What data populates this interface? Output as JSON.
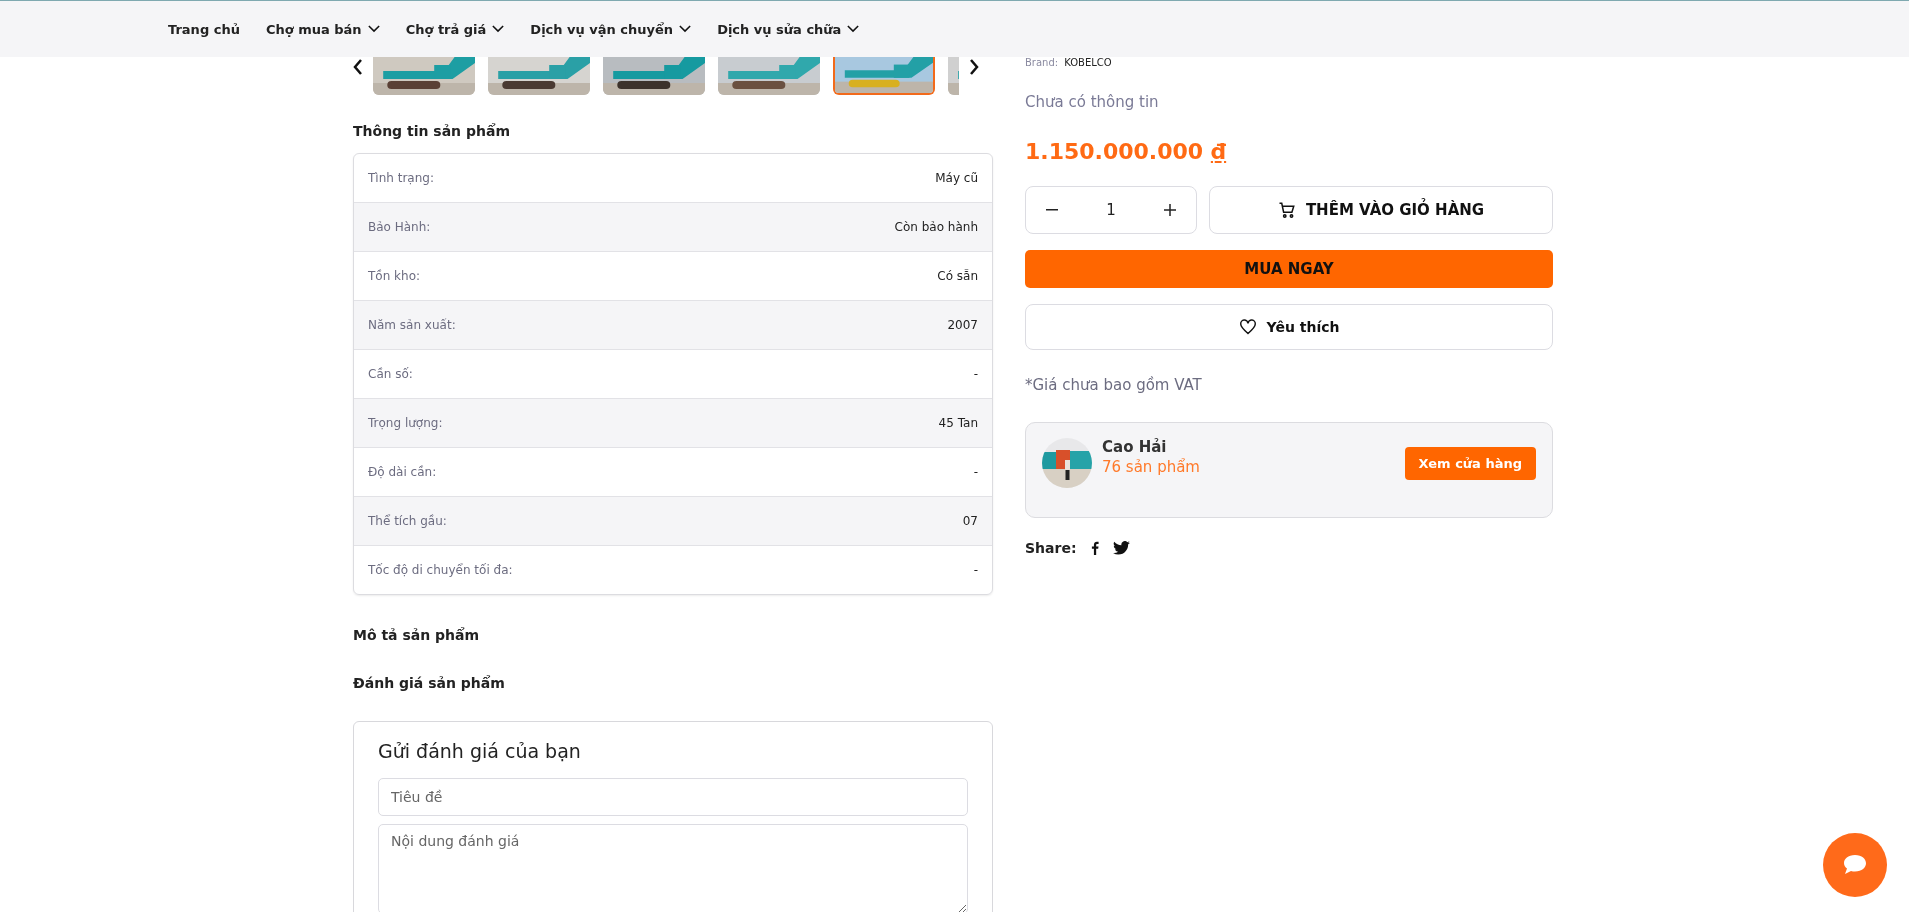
{
  "nav": {
    "items": [
      {
        "label": "Trang chủ",
        "dropdown": false
      },
      {
        "label": "Chợ mua bán",
        "dropdown": true
      },
      {
        "label": "Chợ trả giá",
        "dropdown": true
      },
      {
        "label": "Dịch vụ vận chuyển",
        "dropdown": true
      },
      {
        "label": "Dịch vụ sửa chữa",
        "dropdown": true
      }
    ]
  },
  "gallery": {
    "thumbnails": [
      {
        "kind": "picture",
        "selected": false
      },
      {
        "kind": "picture",
        "selected": false
      },
      {
        "kind": "picture",
        "selected": false
      },
      {
        "kind": "picture",
        "selected": false
      },
      {
        "kind": "picture",
        "selected": true
      },
      {
        "kind": "picture",
        "selected": false
      }
    ]
  },
  "product_info": {
    "title": "Thông tin sản phẩm",
    "rows": [
      {
        "label": "Tình trạng:",
        "value": "Máy cũ"
      },
      {
        "label": "Bảo Hành:",
        "value": "Còn bảo hành"
      },
      {
        "label": "Tồn kho:",
        "value": "Có sẵn"
      },
      {
        "label": "Năm sản xuất:",
        "value": "2007"
      },
      {
        "label": "Cần số:",
        "value": "-"
      },
      {
        "label": "Trọng lượng:",
        "value": "45 Tan"
      },
      {
        "label": "Độ dài cần:",
        "value": "-"
      },
      {
        "label": "Thể tích gầu:",
        "value": "07"
      },
      {
        "label": "Tốc độ di chuyển tối đa:",
        "value": "-"
      }
    ]
  },
  "description": {
    "title": "Mô tả sản phẩm"
  },
  "reviews": {
    "title": "Đánh giá sản phẩm",
    "form": {
      "title": "Gửi đánh giá của bạn",
      "title_field": {
        "placeholder": "Tiêu đề"
      },
      "content_field": {
        "placeholder": "Nội dung đánh giá"
      }
    }
  },
  "details": {
    "brand_label": "Brand:",
    "brand": "KOBELCO",
    "summary": "Chưa có thông tin",
    "price": "1.150.000.000",
    "currency": "₫",
    "quantity": "1",
    "add_to_cart": "THÊM VÀO GIỎ HÀNG",
    "buy_now": "MUA NGAY",
    "favorite": "Yêu thích",
    "vat_note": "*Giá chưa bao gồm VAT"
  },
  "seller": {
    "name": "Cao Hải",
    "products": "76 sản phẩm",
    "button": "Xem cửa hàng"
  },
  "share": {
    "label": "Share:",
    "networks": [
      {
        "kind": "facebook"
      },
      {
        "kind": "twitter"
      }
    ]
  }
}
